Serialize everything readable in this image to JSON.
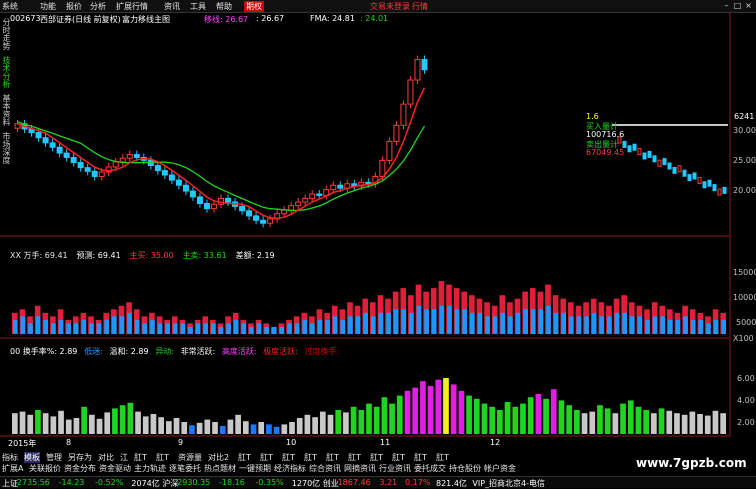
{
  "menu": {
    "items": [
      "系统",
      "功能",
      "报价",
      "分析",
      "扩展行情",
      "资讯",
      "工具",
      "帮助"
    ],
    "active": "期权",
    "right_links": [
      "交易未登录",
      "行情"
    ]
  },
  "sidebar_tabs": [
    "分时走势",
    "技术分析",
    "基本资料",
    "市场深度"
  ],
  "main_header": {
    "code": "002673",
    "name": "西部证券(日线 前复权)",
    "indicator": "富力移线主图",
    "ma_label": "移线: 26.67",
    "ma_value": ": 26.67",
    "fma_label": "FMA: 24.81",
    "fma_value": ": 24.01"
  },
  "right_panel": {
    "price_top": "6241",
    "y_ticks": [
      "30.00",
      "25.00",
      "20.00"
    ],
    "lines": [
      {
        "label": "1.6",
        "color": "#ffff00"
      },
      {
        "label": "买入量计",
        "color": "#22d422"
      },
      {
        "label": "100716.6",
        "color": "#ffffff"
      },
      {
        "label": "卖出量计",
        "color": "#22d422"
      },
      {
        "label": "67049.45",
        "color": "#ff3b3b"
      }
    ]
  },
  "volume_panel": {
    "header": [
      {
        "text": "XX 万手: 69.41",
        "color": "#e6e6e6"
      },
      {
        "text": "预测: 69.41",
        "color": "#ffffff"
      },
      {
        "text": "主买: 35.00",
        "color": "#ff3b3b"
      },
      {
        "text": "主卖: 33.61",
        "color": "#22d422"
      },
      {
        "text": "差额: 2.19",
        "color": "#ffffff"
      }
    ],
    "y_ticks": [
      "15000",
      "10000",
      "5000",
      "X100"
    ]
  },
  "turnover_panel": {
    "header": [
      {
        "text": "00 换手率%: 2.89",
        "color": "#ffffff"
      },
      {
        "text": "低迷: ",
        "color": "#22a0ff"
      },
      {
        "text": "温和: 2.89",
        "color": "#ffffff"
      },
      {
        "text": "异动: ",
        "color": "#22d422"
      },
      {
        "text": "非常活跃: ",
        "color": "#ffffff"
      },
      {
        "text": "高度活跃: ",
        "color": "#ff44ff"
      },
      {
        "text": "极度活跃: ",
        "color": "#ff2222"
      },
      {
        "text": "过度换手: ",
        "color": "#cc0000"
      }
    ],
    "y_ticks": [
      "6.00",
      "4.00",
      "2.00"
    ]
  },
  "x_axis": [
    "2015年",
    "8",
    "9",
    "10",
    "11",
    "12"
  ],
  "chart_data": {
    "type": "bar",
    "title": "富力移线主图",
    "candles": [
      {
        "o": 30.2,
        "c": 30.8
      },
      {
        "o": 30.8,
        "c": 30.1
      },
      {
        "o": 30.1,
        "c": 29.6
      },
      {
        "o": 29.6,
        "c": 28.9
      },
      {
        "o": 28.9,
        "c": 28.2
      },
      {
        "o": 28.2,
        "c": 27.6
      },
      {
        "o": 27.6,
        "c": 26.8
      },
      {
        "o": 26.8,
        "c": 26.2
      },
      {
        "o": 26.2,
        "c": 25.5
      },
      {
        "o": 25.5,
        "c": 24.8
      },
      {
        "o": 24.8,
        "c": 24.3
      },
      {
        "o": 24.3,
        "c": 23.6
      },
      {
        "o": 23.6,
        "c": 24.2
      },
      {
        "o": 24.2,
        "c": 24.9
      },
      {
        "o": 24.9,
        "c": 25.6
      },
      {
        "o": 25.6,
        "c": 26.1
      },
      {
        "o": 26.1,
        "c": 26.6
      },
      {
        "o": 26.6,
        "c": 26.2
      },
      {
        "o": 26.2,
        "c": 25.8
      },
      {
        "o": 25.8,
        "c": 25.1
      },
      {
        "o": 25.1,
        "c": 24.4
      },
      {
        "o": 24.4,
        "c": 23.8
      },
      {
        "o": 23.8,
        "c": 23.1
      },
      {
        "o": 23.1,
        "c": 22.4
      },
      {
        "o": 22.4,
        "c": 21.6
      },
      {
        "o": 21.6,
        "c": 20.8
      },
      {
        "o": 20.8,
        "c": 19.9
      },
      {
        "o": 19.9,
        "c": 19.2
      },
      {
        "o": 19.2,
        "c": 19.8
      },
      {
        "o": 19.8,
        "c": 20.6
      },
      {
        "o": 20.6,
        "c": 20.1
      },
      {
        "o": 20.1,
        "c": 19.5
      },
      {
        "o": 19.5,
        "c": 18.9
      },
      {
        "o": 18.9,
        "c": 18.2
      },
      {
        "o": 18.2,
        "c": 17.6
      },
      {
        "o": 17.6,
        "c": 17.2
      },
      {
        "o": 17.2,
        "c": 17.8
      },
      {
        "o": 17.8,
        "c": 18.5
      },
      {
        "o": 18.5,
        "c": 19.0
      },
      {
        "o": 19.0,
        "c": 19.6
      },
      {
        "o": 19.6,
        "c": 20.1
      },
      {
        "o": 20.1,
        "c": 20.6
      },
      {
        "o": 20.6,
        "c": 21.2
      },
      {
        "o": 21.2,
        "c": 21.0
      },
      {
        "o": 21.0,
        "c": 21.8
      },
      {
        "o": 21.8,
        "c": 22.4
      },
      {
        "o": 22.4,
        "c": 22.0
      },
      {
        "o": 22.0,
        "c": 22.6
      },
      {
        "o": 22.6,
        "c": 22.3
      },
      {
        "o": 22.3,
        "c": 22.8
      },
      {
        "o": 22.8,
        "c": 22.6
      },
      {
        "o": 22.6,
        "c": 23.6
      },
      {
        "o": 23.6,
        "c": 25.8
      },
      {
        "o": 25.8,
        "c": 28.4
      },
      {
        "o": 28.4,
        "c": 30.6
      },
      {
        "o": 30.6,
        "c": 33.5
      },
      {
        "o": 33.5,
        "c": 36.8
      },
      {
        "o": 36.8,
        "c": 39.6
      },
      {
        "o": 39.6,
        "c": 38.2
      }
    ],
    "ylim": [
      16,
      42
    ],
    "volume_red": [
      6,
      7,
      5,
      8,
      6,
      5,
      7,
      4,
      5,
      6,
      5,
      4,
      6,
      7,
      8,
      9,
      7,
      5,
      6,
      5,
      4,
      5,
      4,
      3,
      4,
      5,
      4,
      3,
      5,
      6,
      4,
      3,
      4,
      3,
      2,
      3,
      4,
      5,
      6,
      5,
      7,
      6,
      8,
      7,
      9,
      8,
      10,
      9,
      11,
      10,
      12,
      13,
      11,
      14,
      12,
      13,
      15,
      14,
      13,
      12,
      11,
      10,
      9,
      8,
      11,
      9,
      10,
      12,
      13,
      12,
      14,
      11,
      10,
      9,
      8,
      9,
      10,
      9,
      8,
      10,
      11,
      9,
      8,
      7,
      9,
      8,
      7,
      6,
      8,
      7,
      6,
      5,
      7,
      6
    ],
    "volume_blue": [
      4,
      5,
      3,
      5,
      4,
      3,
      4,
      3,
      3,
      4,
      3,
      3,
      4,
      5,
      5,
      6,
      4,
      3,
      4,
      3,
      3,
      3,
      3,
      2,
      3,
      3,
      3,
      2,
      3,
      4,
      3,
      2,
      3,
      2,
      2,
      2,
      3,
      3,
      4,
      3,
      4,
      4,
      5,
      4,
      5,
      5,
      6,
      5,
      6,
      6,
      7,
      7,
      6,
      8,
      7,
      7,
      8,
      8,
      7,
      7,
      6,
      6,
      5,
      5,
      6,
      5,
      6,
      7,
      7,
      7,
      8,
      6,
      6,
      5,
      5,
      5,
      6,
      5,
      5,
      6,
      6,
      5,
      5,
      4,
      5,
      5,
      4,
      4,
      5,
      4,
      4,
      3,
      4,
      4
    ],
    "volume_ylim": [
      0,
      17
    ],
    "turnover": [
      {
        "v": 2.6,
        "c": "#c8c8c8"
      },
      {
        "v": 2.8,
        "c": "#c8c8c8"
      },
      {
        "v": 2.4,
        "c": "#c8c8c8"
      },
      {
        "v": 3.0,
        "c": "#22d422"
      },
      {
        "v": 2.6,
        "c": "#c8c8c8"
      },
      {
        "v": 2.2,
        "c": "#c8c8c8"
      },
      {
        "v": 2.9,
        "c": "#c8c8c8"
      },
      {
        "v": 1.8,
        "c": "#c8c8c8"
      },
      {
        "v": 2.0,
        "c": "#c8c8c8"
      },
      {
        "v": 3.4,
        "c": "#22d422"
      },
      {
        "v": 2.4,
        "c": "#c8c8c8"
      },
      {
        "v": 1.9,
        "c": "#c8c8c8"
      },
      {
        "v": 2.7,
        "c": "#c8c8c8"
      },
      {
        "v": 3.2,
        "c": "#22d422"
      },
      {
        "v": 3.6,
        "c": "#22d422"
      },
      {
        "v": 3.9,
        "c": "#22d422"
      },
      {
        "v": 2.8,
        "c": "#c8c8c8"
      },
      {
        "v": 2.2,
        "c": "#c8c8c8"
      },
      {
        "v": 2.5,
        "c": "#c8c8c8"
      },
      {
        "v": 2.1,
        "c": "#c8c8c8"
      },
      {
        "v": 1.6,
        "c": "#c8c8c8"
      },
      {
        "v": 2.0,
        "c": "#c8c8c8"
      },
      {
        "v": 1.5,
        "c": "#c8c8c8"
      },
      {
        "v": 1.1,
        "c": "#1e78ff"
      },
      {
        "v": 1.4,
        "c": "#c8c8c8"
      },
      {
        "v": 1.8,
        "c": "#c8c8c8"
      },
      {
        "v": 1.5,
        "c": "#c8c8c8"
      },
      {
        "v": 1.0,
        "c": "#1e78ff"
      },
      {
        "v": 1.8,
        "c": "#c8c8c8"
      },
      {
        "v": 2.4,
        "c": "#c8c8c8"
      },
      {
        "v": 1.6,
        "c": "#c8c8c8"
      },
      {
        "v": 1.2,
        "c": "#1e78ff"
      },
      {
        "v": 1.5,
        "c": "#c8c8c8"
      },
      {
        "v": 1.2,
        "c": "#1e78ff"
      },
      {
        "v": 0.9,
        "c": "#1e78ff"
      },
      {
        "v": 1.2,
        "c": "#c8c8c8"
      },
      {
        "v": 1.5,
        "c": "#c8c8c8"
      },
      {
        "v": 2.0,
        "c": "#c8c8c8"
      },
      {
        "v": 2.4,
        "c": "#c8c8c8"
      },
      {
        "v": 2.1,
        "c": "#c8c8c8"
      },
      {
        "v": 2.8,
        "c": "#c8c8c8"
      },
      {
        "v": 2.4,
        "c": "#c8c8c8"
      },
      {
        "v": 3.0,
        "c": "#22d422"
      },
      {
        "v": 2.7,
        "c": "#c8c8c8"
      },
      {
        "v": 3.4,
        "c": "#22d422"
      },
      {
        "v": 3.0,
        "c": "#22d422"
      },
      {
        "v": 3.8,
        "c": "#22d422"
      },
      {
        "v": 3.4,
        "c": "#22d422"
      },
      {
        "v": 4.6,
        "c": "#22d422"
      },
      {
        "v": 3.8,
        "c": "#22d422"
      },
      {
        "v": 4.8,
        "c": "#22d422"
      },
      {
        "v": 5.4,
        "c": "#e020e0"
      },
      {
        "v": 5.8,
        "c": "#e020e0"
      },
      {
        "v": 6.6,
        "c": "#e020e0"
      },
      {
        "v": 6.0,
        "c": "#e020e0"
      },
      {
        "v": 6.8,
        "c": "#e020e0"
      },
      {
        "v": 7.0,
        "c": "#f0f020"
      },
      {
        "v": 6.2,
        "c": "#e020e0"
      },
      {
        "v": 5.4,
        "c": "#e020e0"
      },
      {
        "v": 4.8,
        "c": "#22d422"
      },
      {
        "v": 4.4,
        "c": "#22d422"
      },
      {
        "v": 3.8,
        "c": "#22d422"
      },
      {
        "v": 3.4,
        "c": "#22d422"
      },
      {
        "v": 3.0,
        "c": "#22d422"
      },
      {
        "v": 4.0,
        "c": "#22d422"
      },
      {
        "v": 3.4,
        "c": "#22d422"
      },
      {
        "v": 3.8,
        "c": "#22d422"
      },
      {
        "v": 4.6,
        "c": "#22d422"
      },
      {
        "v": 5.0,
        "c": "#e020e0"
      },
      {
        "v": 4.4,
        "c": "#22d422"
      },
      {
        "v": 5.6,
        "c": "#e020e0"
      },
      {
        "v": 4.2,
        "c": "#22d422"
      },
      {
        "v": 3.6,
        "c": "#22d422"
      },
      {
        "v": 3.0,
        "c": "#22d422"
      },
      {
        "v": 2.6,
        "c": "#c8c8c8"
      },
      {
        "v": 2.8,
        "c": "#c8c8c8"
      },
      {
        "v": 3.6,
        "c": "#22d422"
      },
      {
        "v": 3.2,
        "c": "#22d422"
      },
      {
        "v": 2.6,
        "c": "#c8c8c8"
      },
      {
        "v": 3.8,
        "c": "#22d422"
      },
      {
        "v": 4.2,
        "c": "#22d422"
      },
      {
        "v": 3.4,
        "c": "#22d422"
      },
      {
        "v": 3.0,
        "c": "#22d422"
      },
      {
        "v": 2.6,
        "c": "#c8c8c8"
      },
      {
        "v": 3.2,
        "c": "#22d422"
      },
      {
        "v": 2.9,
        "c": "#c8c8c8"
      },
      {
        "v": 2.6,
        "c": "#c8c8c8"
      },
      {
        "v": 2.4,
        "c": "#c8c8c8"
      },
      {
        "v": 2.8,
        "c": "#c8c8c8"
      },
      {
        "v": 2.5,
        "c": "#c8c8c8"
      },
      {
        "v": 2.3,
        "c": "#c8c8c8"
      },
      {
        "v": 2.9,
        "c": "#c8c8c8"
      },
      {
        "v": 2.6,
        "c": "#c8c8c8"
      }
    ],
    "turnover_ylim": [
      0,
      8
    ]
  },
  "bottom_tabs_row1": [
    "指标",
    "模板",
    "管理",
    "另存为",
    "对比",
    "江",
    "肛T",
    "肛T",
    "资源量",
    "对比2",
    "肛T",
    "肛T",
    "肛T",
    "肛T",
    "肛T",
    "肛T",
    "肛T",
    "肛T",
    "肛T",
    "肛T"
  ],
  "bottom_tabs_row2": [
    "扩展A",
    "关联报价",
    "资金分布",
    "资金驱动",
    "主力轨迹",
    "逐笔委托",
    "热点题材",
    "一键预期",
    "经济指标",
    "综合资讯",
    "网摘资讯",
    "行业资讯",
    "委托成交",
    "持仓股份",
    "帐户资金"
  ],
  "watermark": "www.7gpzb.com",
  "status": [
    {
      "text": "上证",
      "color": "#ffffff"
    },
    {
      "text": "2735.56",
      "color": "#22d422"
    },
    {
      "text": "-14.23",
      "color": "#22d422"
    },
    {
      "text": "-0.52%",
      "color": "#22d422"
    },
    {
      "text": "2074亿",
      "color": "#ffffff"
    },
    {
      "text": "沪深",
      "color": "#ffffff"
    },
    {
      "text": "2930.35",
      "color": "#22d422"
    },
    {
      "text": "-18.16",
      "color": "#22d422"
    },
    {
      "text": "-0.35%",
      "color": "#22d422"
    },
    {
      "text": "1270亿",
      "color": "#ffffff"
    },
    {
      "text": "创业",
      "color": "#ffffff"
    },
    {
      "text": "1867.46",
      "color": "#ff3b3b"
    },
    {
      "text": "3.21",
      "color": "#ff3b3b"
    },
    {
      "text": "0.17%",
      "color": "#ff3b3b"
    },
    {
      "text": "821.4亿",
      "color": "#ffffff"
    },
    {
      "text": "VIP_招商北京4-电信",
      "color": "#ffffff"
    }
  ]
}
